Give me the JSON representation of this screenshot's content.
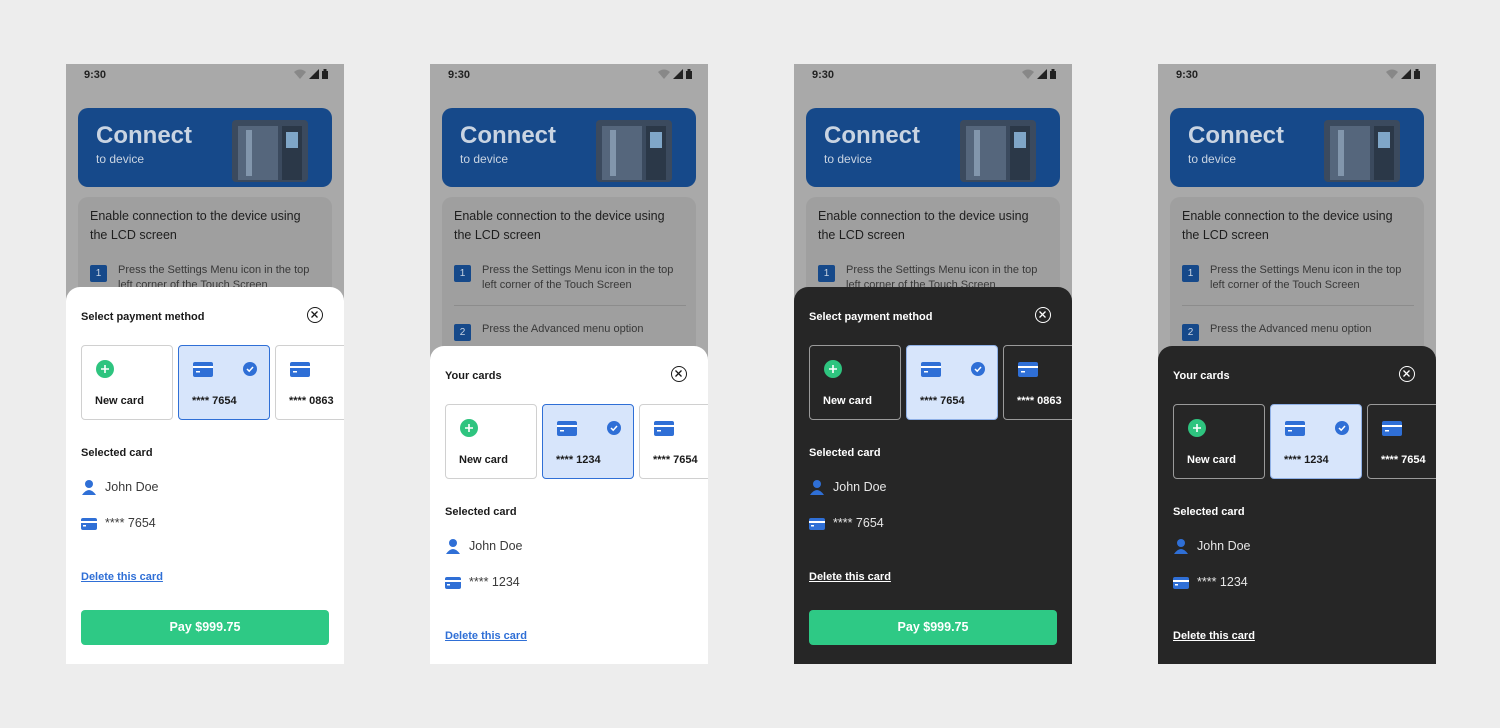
{
  "status": {
    "time": "9:30"
  },
  "banner": {
    "title": "Connect",
    "subtitle": "to device"
  },
  "instructions": {
    "lead": "Enable connection to the device using the LCD screen",
    "steps": [
      {
        "num": "1",
        "text": "Press the Settings Menu icon in the top left corner of the Touch Screen"
      },
      {
        "num": "2",
        "text": "Press the Advanced menu option"
      }
    ]
  },
  "screens": [
    {
      "theme": "light",
      "title": "Select payment method",
      "tiles": {
        "new": "New card",
        "selected": "**** 7654",
        "other": "**** 0863"
      },
      "selected_label": "Selected card",
      "user_name": "John Doe",
      "card_number": "**** 7654",
      "delete_label": "Delete this card",
      "pay_label": "Pay $999.75"
    },
    {
      "theme": "light",
      "title": "Your cards",
      "tiles": {
        "new": "New card",
        "selected": "**** 1234",
        "other": "**** 7654"
      },
      "selected_label": "Selected card",
      "user_name": "John Doe",
      "card_number": "**** 1234",
      "delete_label": "Delete this card"
    },
    {
      "theme": "dark",
      "title": "Select payment method",
      "tiles": {
        "new": "New card",
        "selected": "**** 7654",
        "other": "**** 0863"
      },
      "selected_label": "Selected card",
      "user_name": "John Doe",
      "card_number": "**** 7654",
      "delete_label": "Delete this card",
      "pay_label": "Pay $999.75"
    },
    {
      "theme": "dark",
      "title": "Your cards",
      "tiles": {
        "new": "New card",
        "selected": "**** 1234",
        "other": "**** 7654"
      },
      "selected_label": "Selected card",
      "user_name": "John Doe",
      "card_number": "**** 1234",
      "delete_label": "Delete this card"
    }
  ],
  "colors": {
    "accent_green": "#2ec985",
    "accent_blue": "#2f6fd6",
    "brand_navy": "#16498a",
    "dark_sheet": "#262626",
    "canvas": "#ededed"
  }
}
